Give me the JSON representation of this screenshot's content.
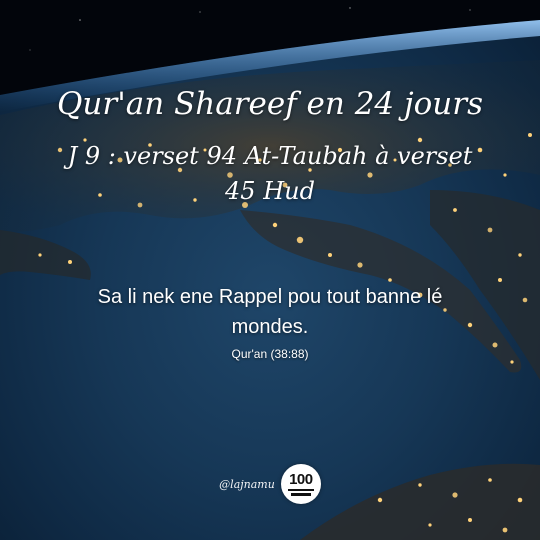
{
  "title": {
    "main": "Qur'an Shareef en 24 jours",
    "line1": "J 9 : verset 94 At-Taubah à verset",
    "line2": "45 Hud"
  },
  "quote": {
    "text": "Sa li nek ene Rappel pou tout banne lé mondes.",
    "reference": "Qur'an (38:88)"
  },
  "footer": {
    "handle": "@lajnamu",
    "badge_number": "100"
  },
  "colors": {
    "ocean": "#163756",
    "text": "#ffffff",
    "city_lights": "#ffd27a",
    "atmosphere": "#6fb4ff"
  }
}
